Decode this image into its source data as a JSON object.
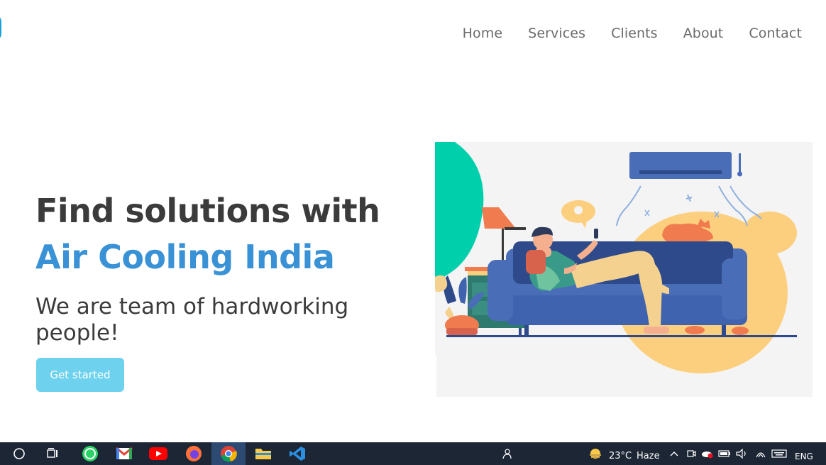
{
  "nav": {
    "items": [
      {
        "label": "Home"
      },
      {
        "label": "Services"
      },
      {
        "label": "Clients"
      },
      {
        "label": "About"
      },
      {
        "label": "Contact"
      }
    ]
  },
  "hero": {
    "title": "Find solutions with",
    "brand": "Air Cooling India",
    "subtitle": "We are team of hardworking people!",
    "cta_label": "Get started"
  },
  "taskbar": {
    "apps": [
      "search-icon",
      "task-view-icon",
      "whatsapp-icon",
      "gmail-icon",
      "youtube-icon",
      "firefox-icon",
      "chrome-icon",
      "file-explorer-icon",
      "vscode-icon"
    ],
    "weather": {
      "temp": "23°C",
      "condition": "Haze"
    },
    "language": "ENG"
  },
  "colors": {
    "accent": "#3a92d6",
    "cta": "#6ed2ee",
    "taskbar": "#1c2635"
  }
}
